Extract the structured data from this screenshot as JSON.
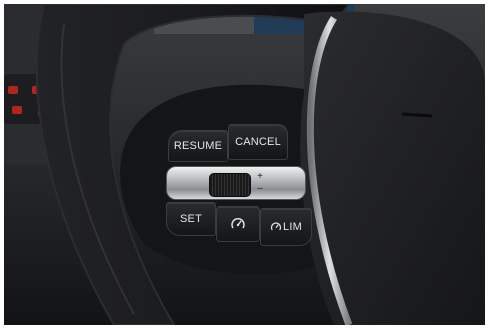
{
  "controls": {
    "resume_label": "RESUME",
    "cancel_label": "CANCEL",
    "set_label": "SET",
    "lim_label": "LIM",
    "plus_symbol": "+",
    "minus_symbol": "–"
  },
  "icons": {
    "cruise": "cruise-control-icon",
    "limiter": "speed-limiter-icon"
  },
  "colors": {
    "button_face": "#1e1f22",
    "label_text": "#e6e6e6",
    "chrome_trim": "#c9cbce",
    "steering_wheel": "#161719"
  }
}
